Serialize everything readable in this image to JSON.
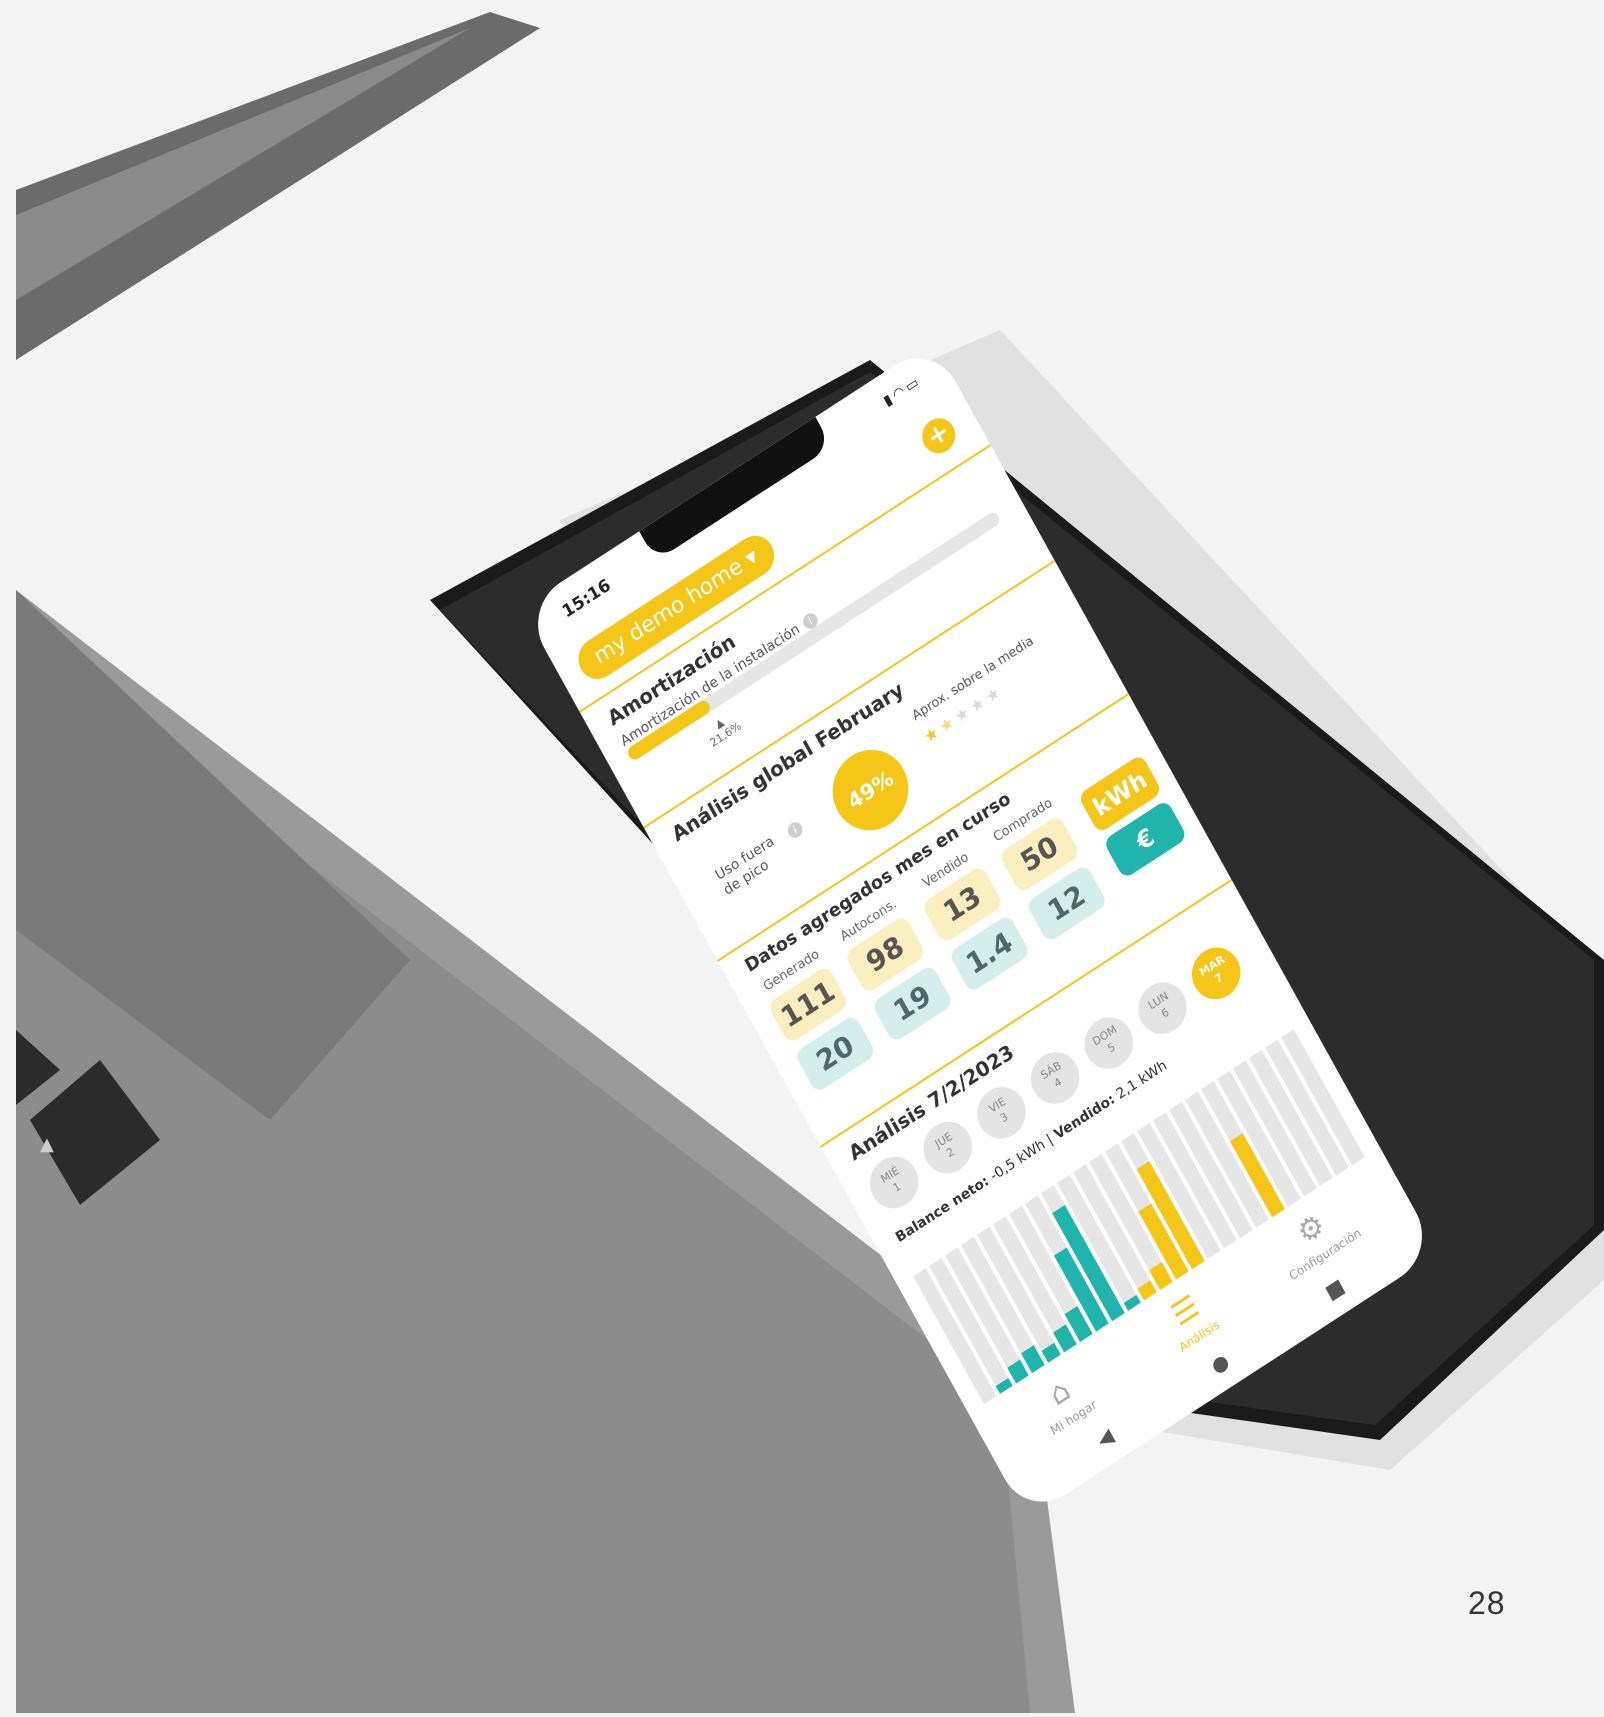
{
  "page_number": "28",
  "colors": {
    "accent": "#f5c518",
    "teal": "#1fb5ac",
    "kwh_box": "#fbeebf",
    "eur_box": "#d4eeee"
  },
  "status_bar": {
    "time": "15:16",
    "icons": [
      "signal-icon",
      "wifi-icon",
      "battery-icon"
    ]
  },
  "header": {
    "home_selector": "my demo home ▾",
    "add_label": "+"
  },
  "amortizacion": {
    "title": "Amortización",
    "label": "Amortización de la instalación",
    "marker": "▲",
    "progress_label": "21,6%",
    "progress_value": 0.216
  },
  "analisis_global": {
    "title": "Análisis global February",
    "uso_label_1": "Uso fuera",
    "uso_label_2": "de pico",
    "percent": "49%",
    "rating_label": "Aprox. sobre la media",
    "rating": 1.5,
    "rating_max": 5
  },
  "datos_agregados": {
    "title": "Datos agregados mes en curso",
    "columns": [
      {
        "label": "Generado",
        "kwh": "111",
        "eur": "20"
      },
      {
        "label": "Autocons.",
        "kwh": "98",
        "eur": "19"
      },
      {
        "label": "Vendido",
        "kwh": "13",
        "eur": "1.4"
      },
      {
        "label": "Comprado",
        "kwh": "50",
        "eur": "12"
      }
    ],
    "unit_kwh": "kWh",
    "unit_eur": "€"
  },
  "analisis_dia": {
    "title": "Análisis 7/2/2023",
    "days": [
      {
        "day": "MIÉ",
        "num": "1",
        "active": false
      },
      {
        "day": "JUE",
        "num": "2",
        "active": false
      },
      {
        "day": "VIE",
        "num": "3",
        "active": false
      },
      {
        "day": "SÁB",
        "num": "4",
        "active": false
      },
      {
        "day": "DOM",
        "num": "5",
        "active": false
      },
      {
        "day": "LUN",
        "num": "6",
        "active": false
      },
      {
        "day": "MAR",
        "num": "7",
        "active": true
      }
    ],
    "balance_label": "Balance neto:",
    "balance_value": " -0,5 kWh | ",
    "vendido_label": "Vendido:",
    "vendido_value": " 2,1 kWh"
  },
  "chart_data": {
    "type": "bar",
    "categories": [
      "0",
      "1",
      "2",
      "3",
      "4",
      "5",
      "6",
      "7",
      "8",
      "9",
      "10",
      "11",
      "12",
      "13",
      "14",
      "15",
      "16",
      "17",
      "18",
      "19",
      "20",
      "21",
      "22",
      "23"
    ],
    "series": [
      {
        "values": [
          0,
          0.05,
          0.07,
          0.08,
          0.06,
          0.08,
          0.1,
          0.22,
          0.3,
          0.05,
          0,
          0,
          0,
          0,
          0,
          0,
          0,
          0,
          0,
          0,
          0,
          0,
          0,
          0
        ]
      },
      {
        "values": [
          0,
          0,
          0,
          0,
          0,
          0,
          0,
          0,
          0,
          0,
          0.06,
          0.08,
          0.2,
          0.28,
          0,
          0,
          0,
          0,
          0.22,
          0,
          0,
          0,
          0,
          0
        ]
      }
    ]
  },
  "nav": [
    {
      "label": "Mi hogar",
      "icon": "home-icon",
      "active": false
    },
    {
      "label": "Análisis",
      "icon": "sliders-icon",
      "active": true
    },
    {
      "label": "Configuración",
      "icon": "gear-icon",
      "active": false
    }
  ]
}
